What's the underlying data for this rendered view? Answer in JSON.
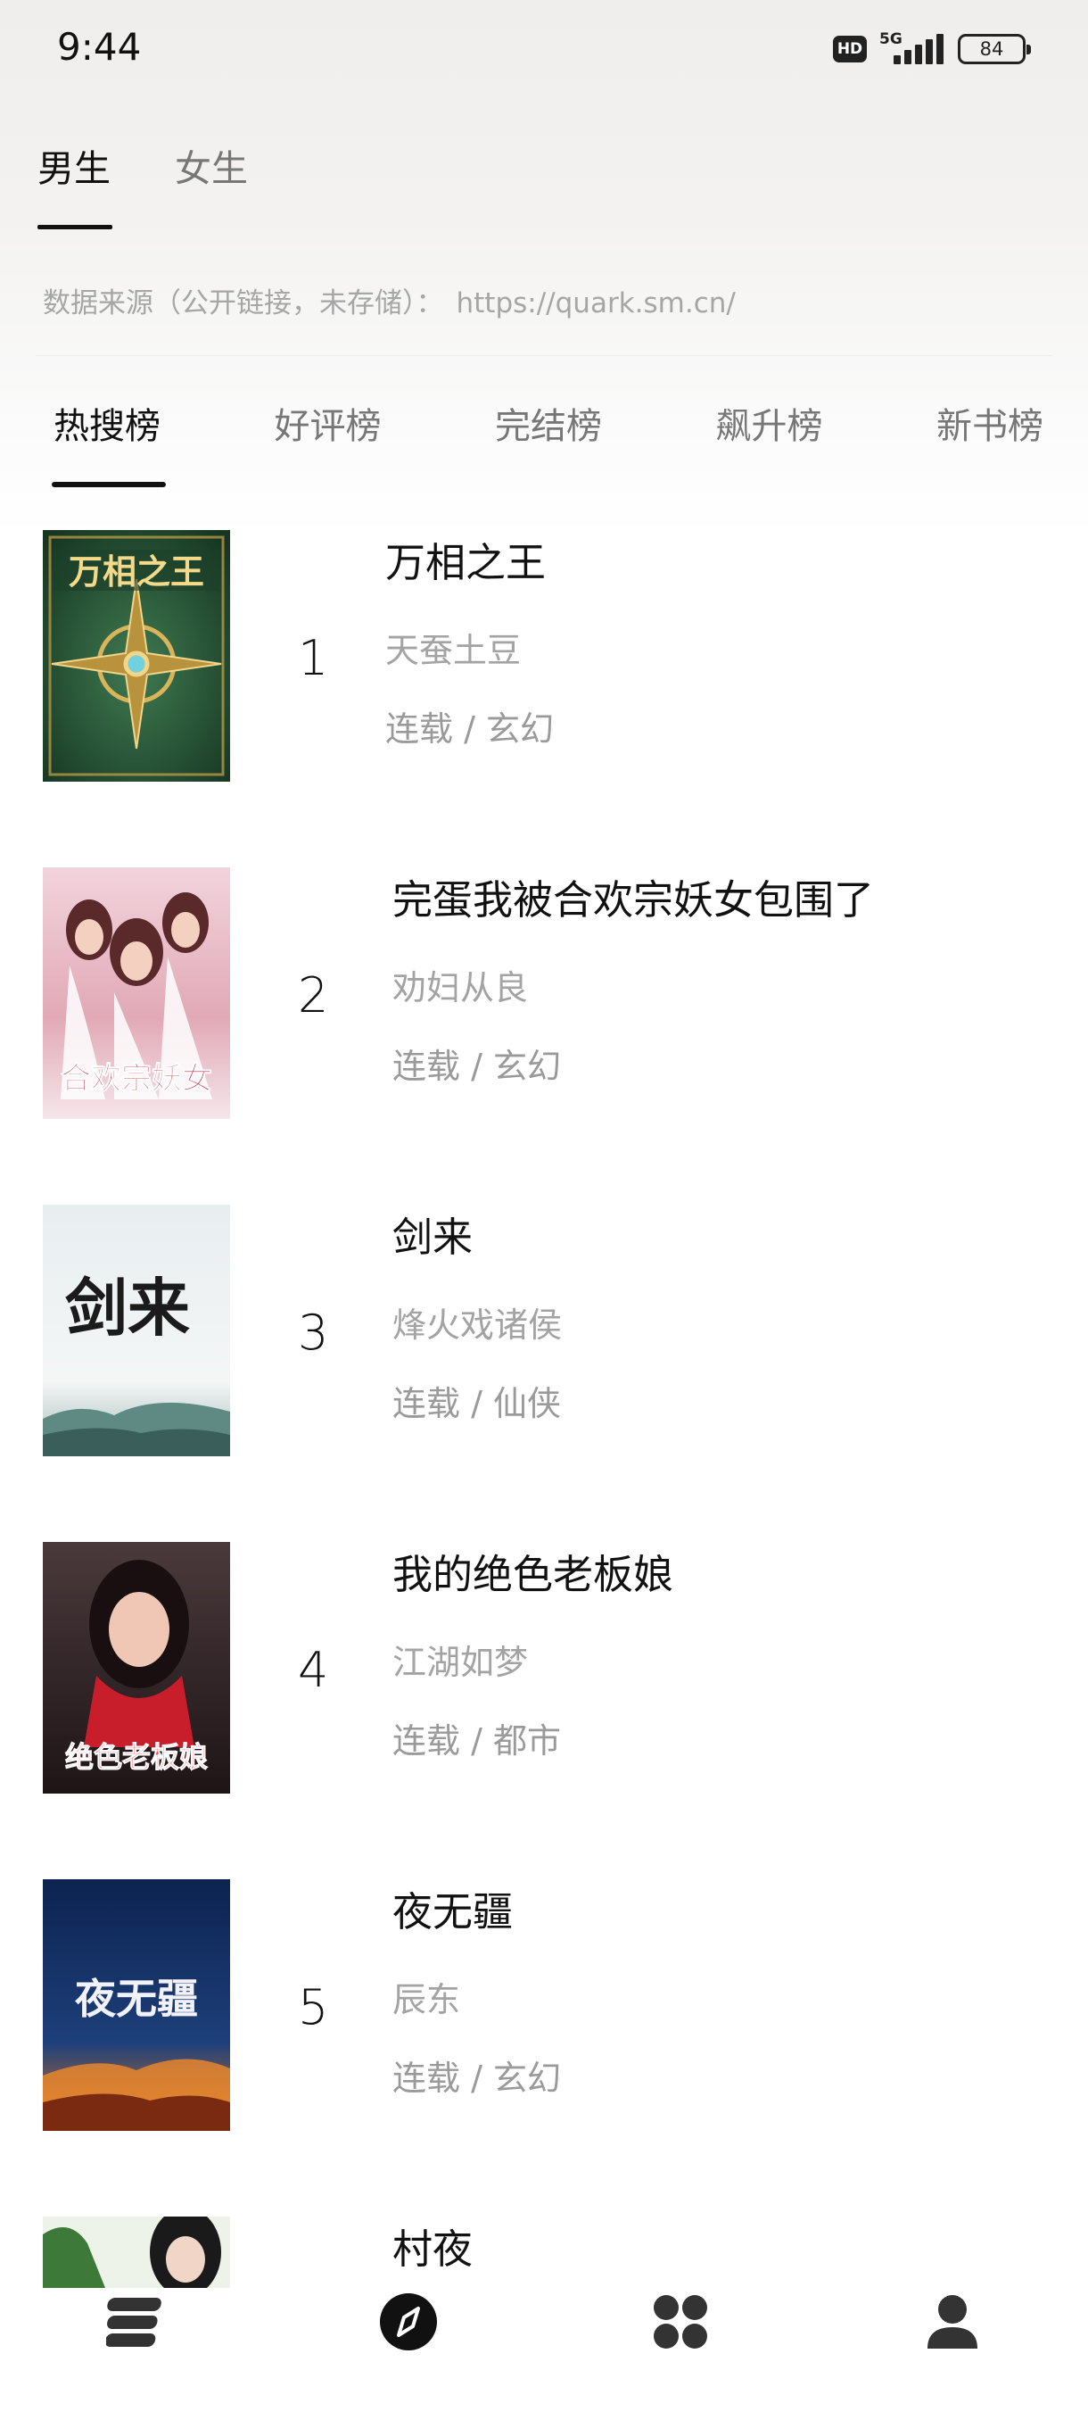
{
  "status_bar": {
    "time": "9:44",
    "network": "5G",
    "hd": "HD",
    "battery": "84"
  },
  "gender_tabs": [
    {
      "label": "男生",
      "active": true
    },
    {
      "label": "女生",
      "active": false
    }
  ],
  "source": {
    "label": "数据来源（公开链接，未存储）：",
    "url": "https://quark.sm.cn/"
  },
  "rank_tabs": [
    {
      "label": "热搜榜",
      "active": true
    },
    {
      "label": "好评榜",
      "active": false
    },
    {
      "label": "完结榜",
      "active": false
    },
    {
      "label": "飙升榜",
      "active": false
    },
    {
      "label": "新书榜",
      "active": false
    }
  ],
  "books": [
    {
      "rank": "1",
      "title": "万相之王",
      "author": "天蚕土豆",
      "tags": "连载 / 玄幻"
    },
    {
      "rank": "2",
      "title": "完蛋我被合欢宗妖女包围了",
      "author": "劝妇从良",
      "tags": "连载 / 玄幻"
    },
    {
      "rank": "3",
      "title": "剑来",
      "author": "烽火戏诸侯",
      "tags": "连载 / 仙侠"
    },
    {
      "rank": "4",
      "title": "我的绝色老板娘",
      "author": "江湖如梦",
      "tags": "连载 / 都市"
    },
    {
      "rank": "5",
      "title": "夜无疆",
      "author": "辰东",
      "tags": "连载 / 玄幻"
    },
    {
      "rank": "6",
      "title": "村夜",
      "author": "",
      "tags": ""
    }
  ],
  "covers": {
    "1": {
      "title": "万相之王",
      "palette": [
        "#2e5a3c",
        "#1c3f2a",
        "#c9a44a"
      ]
    },
    "2": {
      "title": "合欢宗妖女",
      "palette": [
        "#e9c7cf",
        "#b7425a",
        "#f3e3e6"
      ]
    },
    "3": {
      "title": "剑来",
      "palette": [
        "#dfe7ea",
        "#2c3a3f",
        "#7fa3a8"
      ]
    },
    "4": {
      "title": "绝色老板娘",
      "palette": [
        "#3a2a2e",
        "#c81e2c",
        "#f0c6b5"
      ]
    },
    "5": {
      "title": "夜无疆",
      "palette": [
        "#0f2a5a",
        "#f08a2a",
        "#e8e8f0"
      ]
    }
  },
  "bottom_nav": [
    {
      "icon": "bookshelf-icon"
    },
    {
      "icon": "compass-icon"
    },
    {
      "icon": "category-grid-icon"
    },
    {
      "icon": "profile-icon"
    }
  ]
}
